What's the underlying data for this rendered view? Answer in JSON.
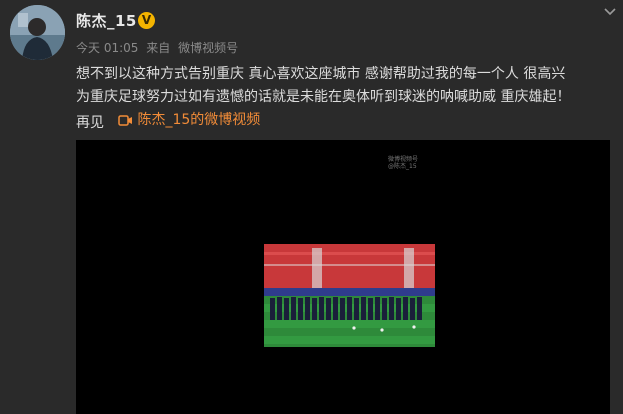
{
  "post": {
    "username": "陈杰_15",
    "verified_badge": "V",
    "time": "今天 01:05",
    "source_prefix": "来自",
    "source": "微博视频号",
    "content_line1": "想不到以这种方式告别重庆 真心喜欢这座城市 感谢帮助过我的每一个人 很高兴",
    "content_line2": "为重庆足球努力过如有遗憾的话就是未能在奥体听到球迷的呐喊助威 重庆雄起！",
    "content_farewell": "再见",
    "video_link_label": "陈杰_15的微博视频"
  },
  "video": {
    "watermark_brand": "微博视频号",
    "watermark_handle": "@陈杰_15"
  },
  "icons": {
    "avatar": "avatar-photo",
    "verified": "verified-badge-icon",
    "menu": "chevron-down-icon",
    "video_link": "video-camera-icon"
  },
  "colors": {
    "background": "#2a2a2a",
    "link": "#f28c38",
    "verified": "#f4b400",
    "meta_text": "#8a8a8a"
  }
}
